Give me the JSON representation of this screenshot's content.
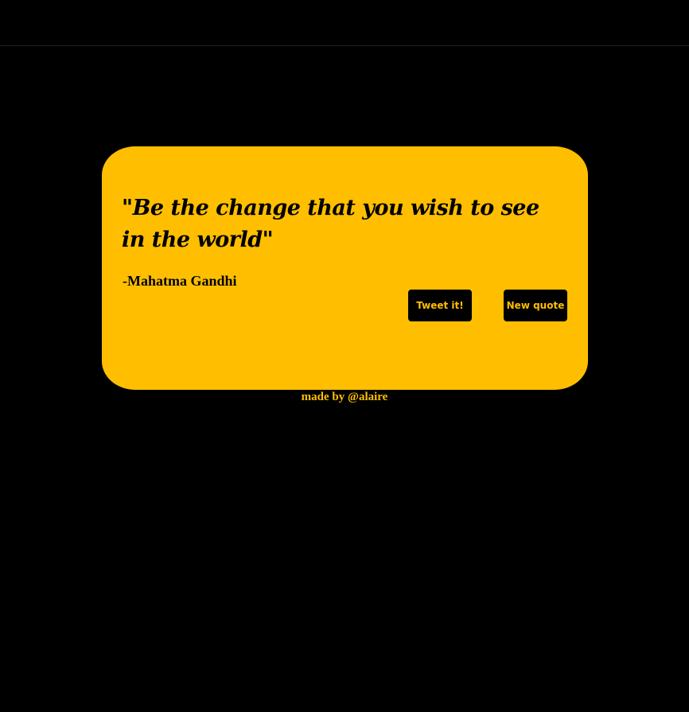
{
  "colors": {
    "background": "#000000",
    "accent": "#ffbf00",
    "text_on_accent": "#000000"
  },
  "quote": {
    "text": "\"Be the change that you wish to see in the world\"",
    "author": "-Mahatma Gandhi"
  },
  "buttons": {
    "tweet_label": "Tweet it!",
    "new_quote_label": "New quote"
  },
  "footer": {
    "prefix": "made by ",
    "handle": "@alaire"
  }
}
